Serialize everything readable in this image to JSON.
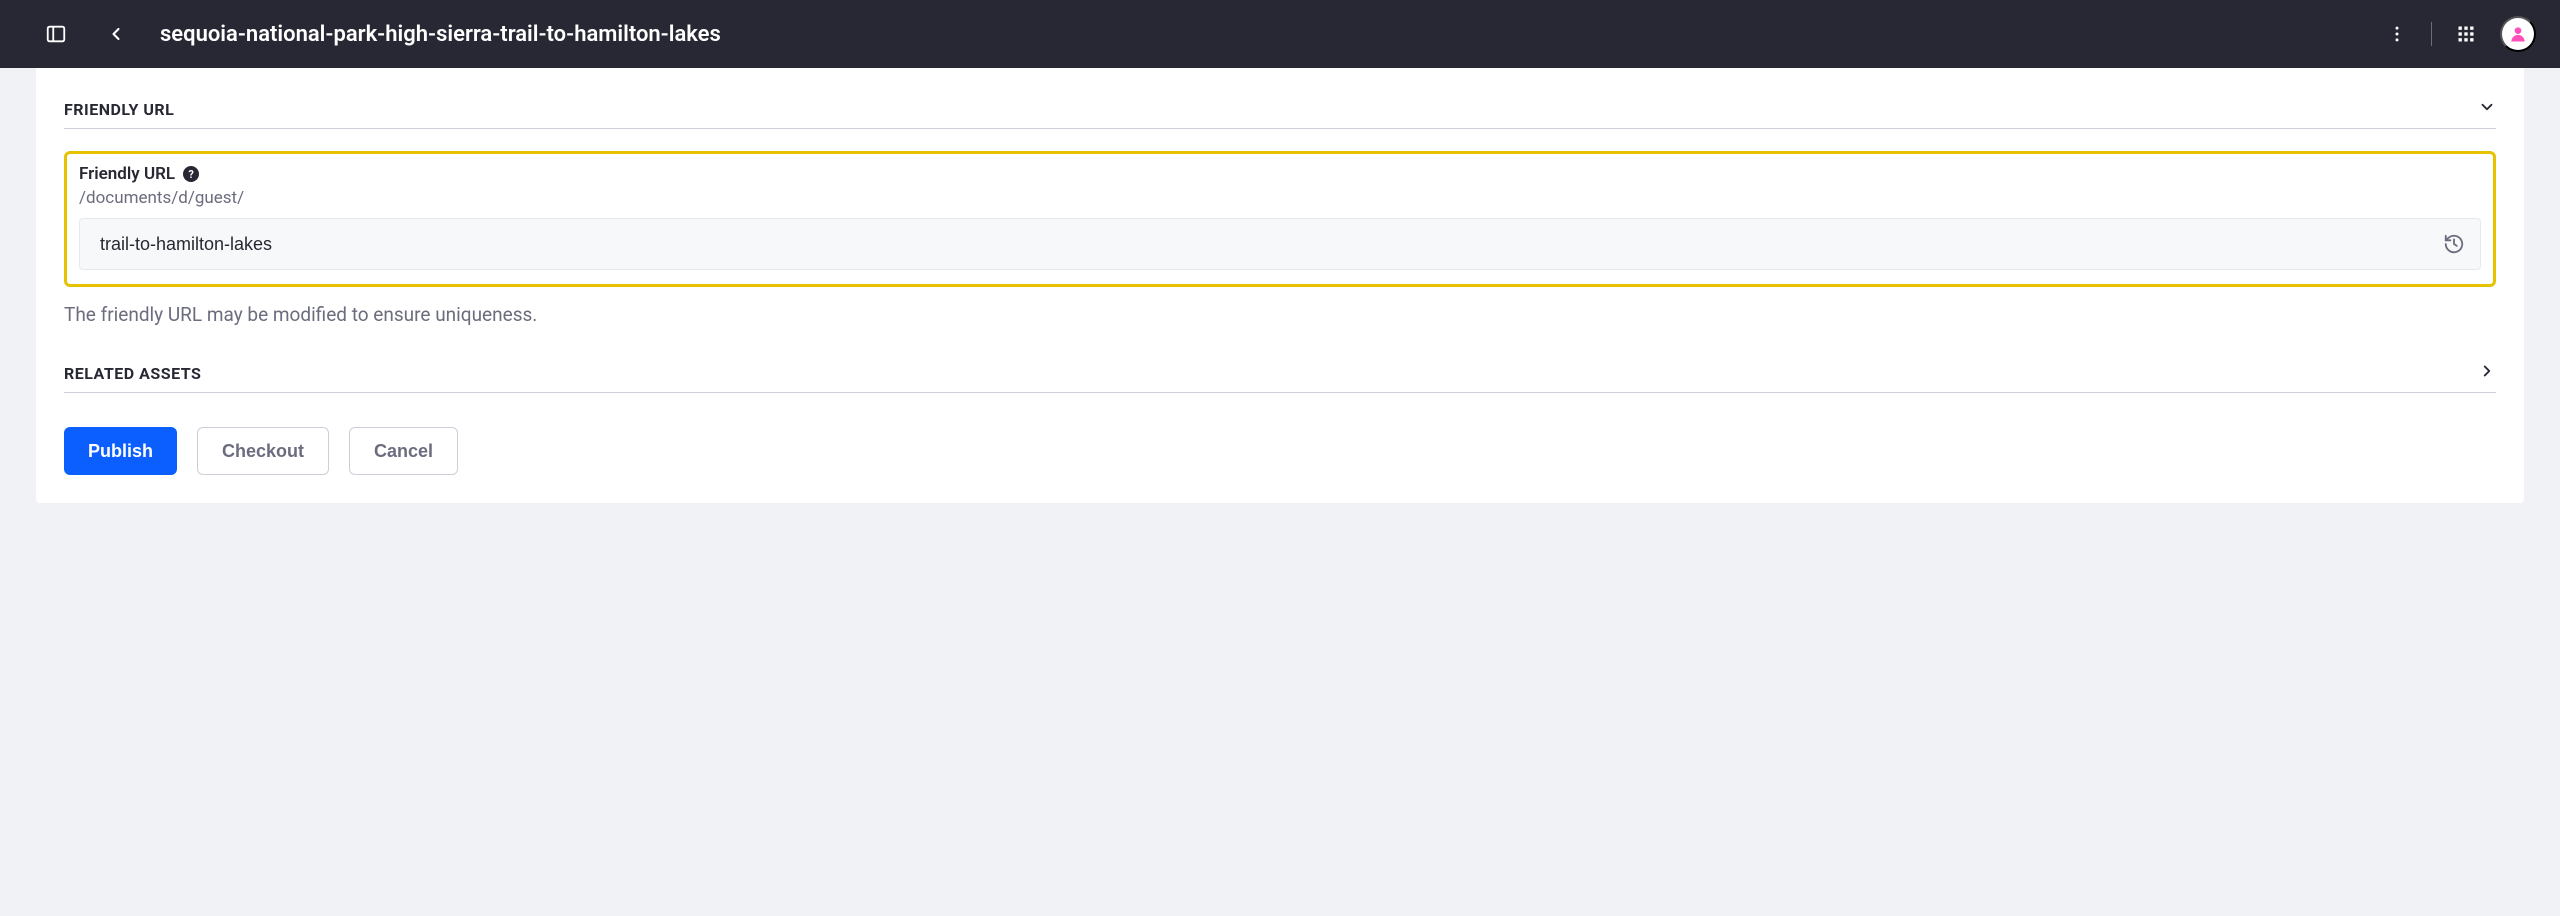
{
  "topbar": {
    "title": "sequoia-national-park-high-sierra-trail-to-hamilton-lakes"
  },
  "sections": {
    "friendly_url": {
      "header": "FRIENDLY URL",
      "field_label": "Friendly URL",
      "url_prefix": "/documents/d/guest/",
      "value": "trail-to-hamilton-lakes",
      "help_text": "The friendly URL may be modified to ensure uniqueness."
    },
    "related_assets": {
      "header": "RELATED ASSETS"
    }
  },
  "buttons": {
    "publish": "Publish",
    "checkout": "Checkout",
    "cancel": "Cancel"
  }
}
